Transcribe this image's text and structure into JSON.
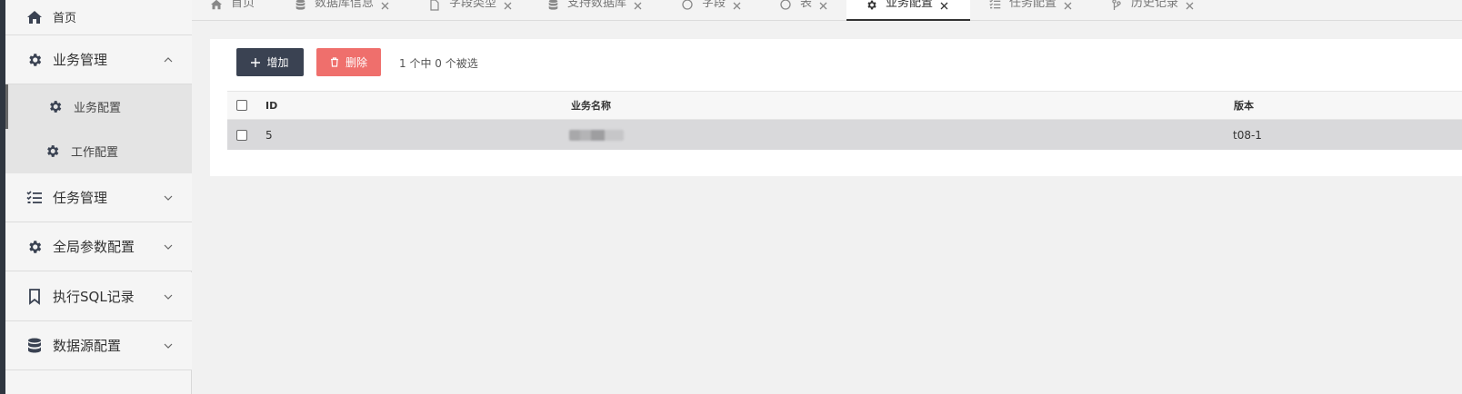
{
  "sidebar": {
    "home_label": "首页",
    "business_mgmt": {
      "label": "业务管理",
      "children": [
        {
          "label": "业务配置",
          "active": true
        },
        {
          "label": "工作配置",
          "active": false
        }
      ]
    },
    "items": [
      {
        "label": "任务管理",
        "icon": "list-check-icon"
      },
      {
        "label": "全局参数配置",
        "icon": "gear-icon"
      },
      {
        "label": "执行SQL记录",
        "icon": "bookmark-icon"
      },
      {
        "label": "数据源配置",
        "icon": "database-icon"
      }
    ]
  },
  "tabs": [
    {
      "label": "首页",
      "icon": "home-icon",
      "closable": false
    },
    {
      "label": "数据库信息",
      "icon": "database-icon",
      "closable": true
    },
    {
      "label": "字段类型",
      "icon": "file-icon",
      "closable": true
    },
    {
      "label": "支持数据库",
      "icon": "database-icon",
      "closable": true
    },
    {
      "label": "字段",
      "icon": "circle-icon",
      "closable": true
    },
    {
      "label": "表",
      "icon": "circle-icon",
      "closable": true
    },
    {
      "label": "业务配置",
      "icon": "gear-icon",
      "closable": true,
      "active": true
    },
    {
      "label": "任务配置",
      "icon": "list-check-icon",
      "closable": true
    },
    {
      "label": "历史记录",
      "icon": "branch-icon",
      "closable": true
    }
  ],
  "toolbar": {
    "add_label": "增加",
    "delete_label": "删除",
    "selection_info": "1 个中 0 个被选"
  },
  "table": {
    "columns": [
      "ID",
      "业务名称",
      "版本"
    ],
    "rows": [
      {
        "id": "5",
        "name": "",
        "version": "t08-1"
      }
    ]
  },
  "colors": {
    "primary_button": "#3a4252",
    "danger_button": "#ef6f6c",
    "selected_row": "#d9d9db"
  }
}
